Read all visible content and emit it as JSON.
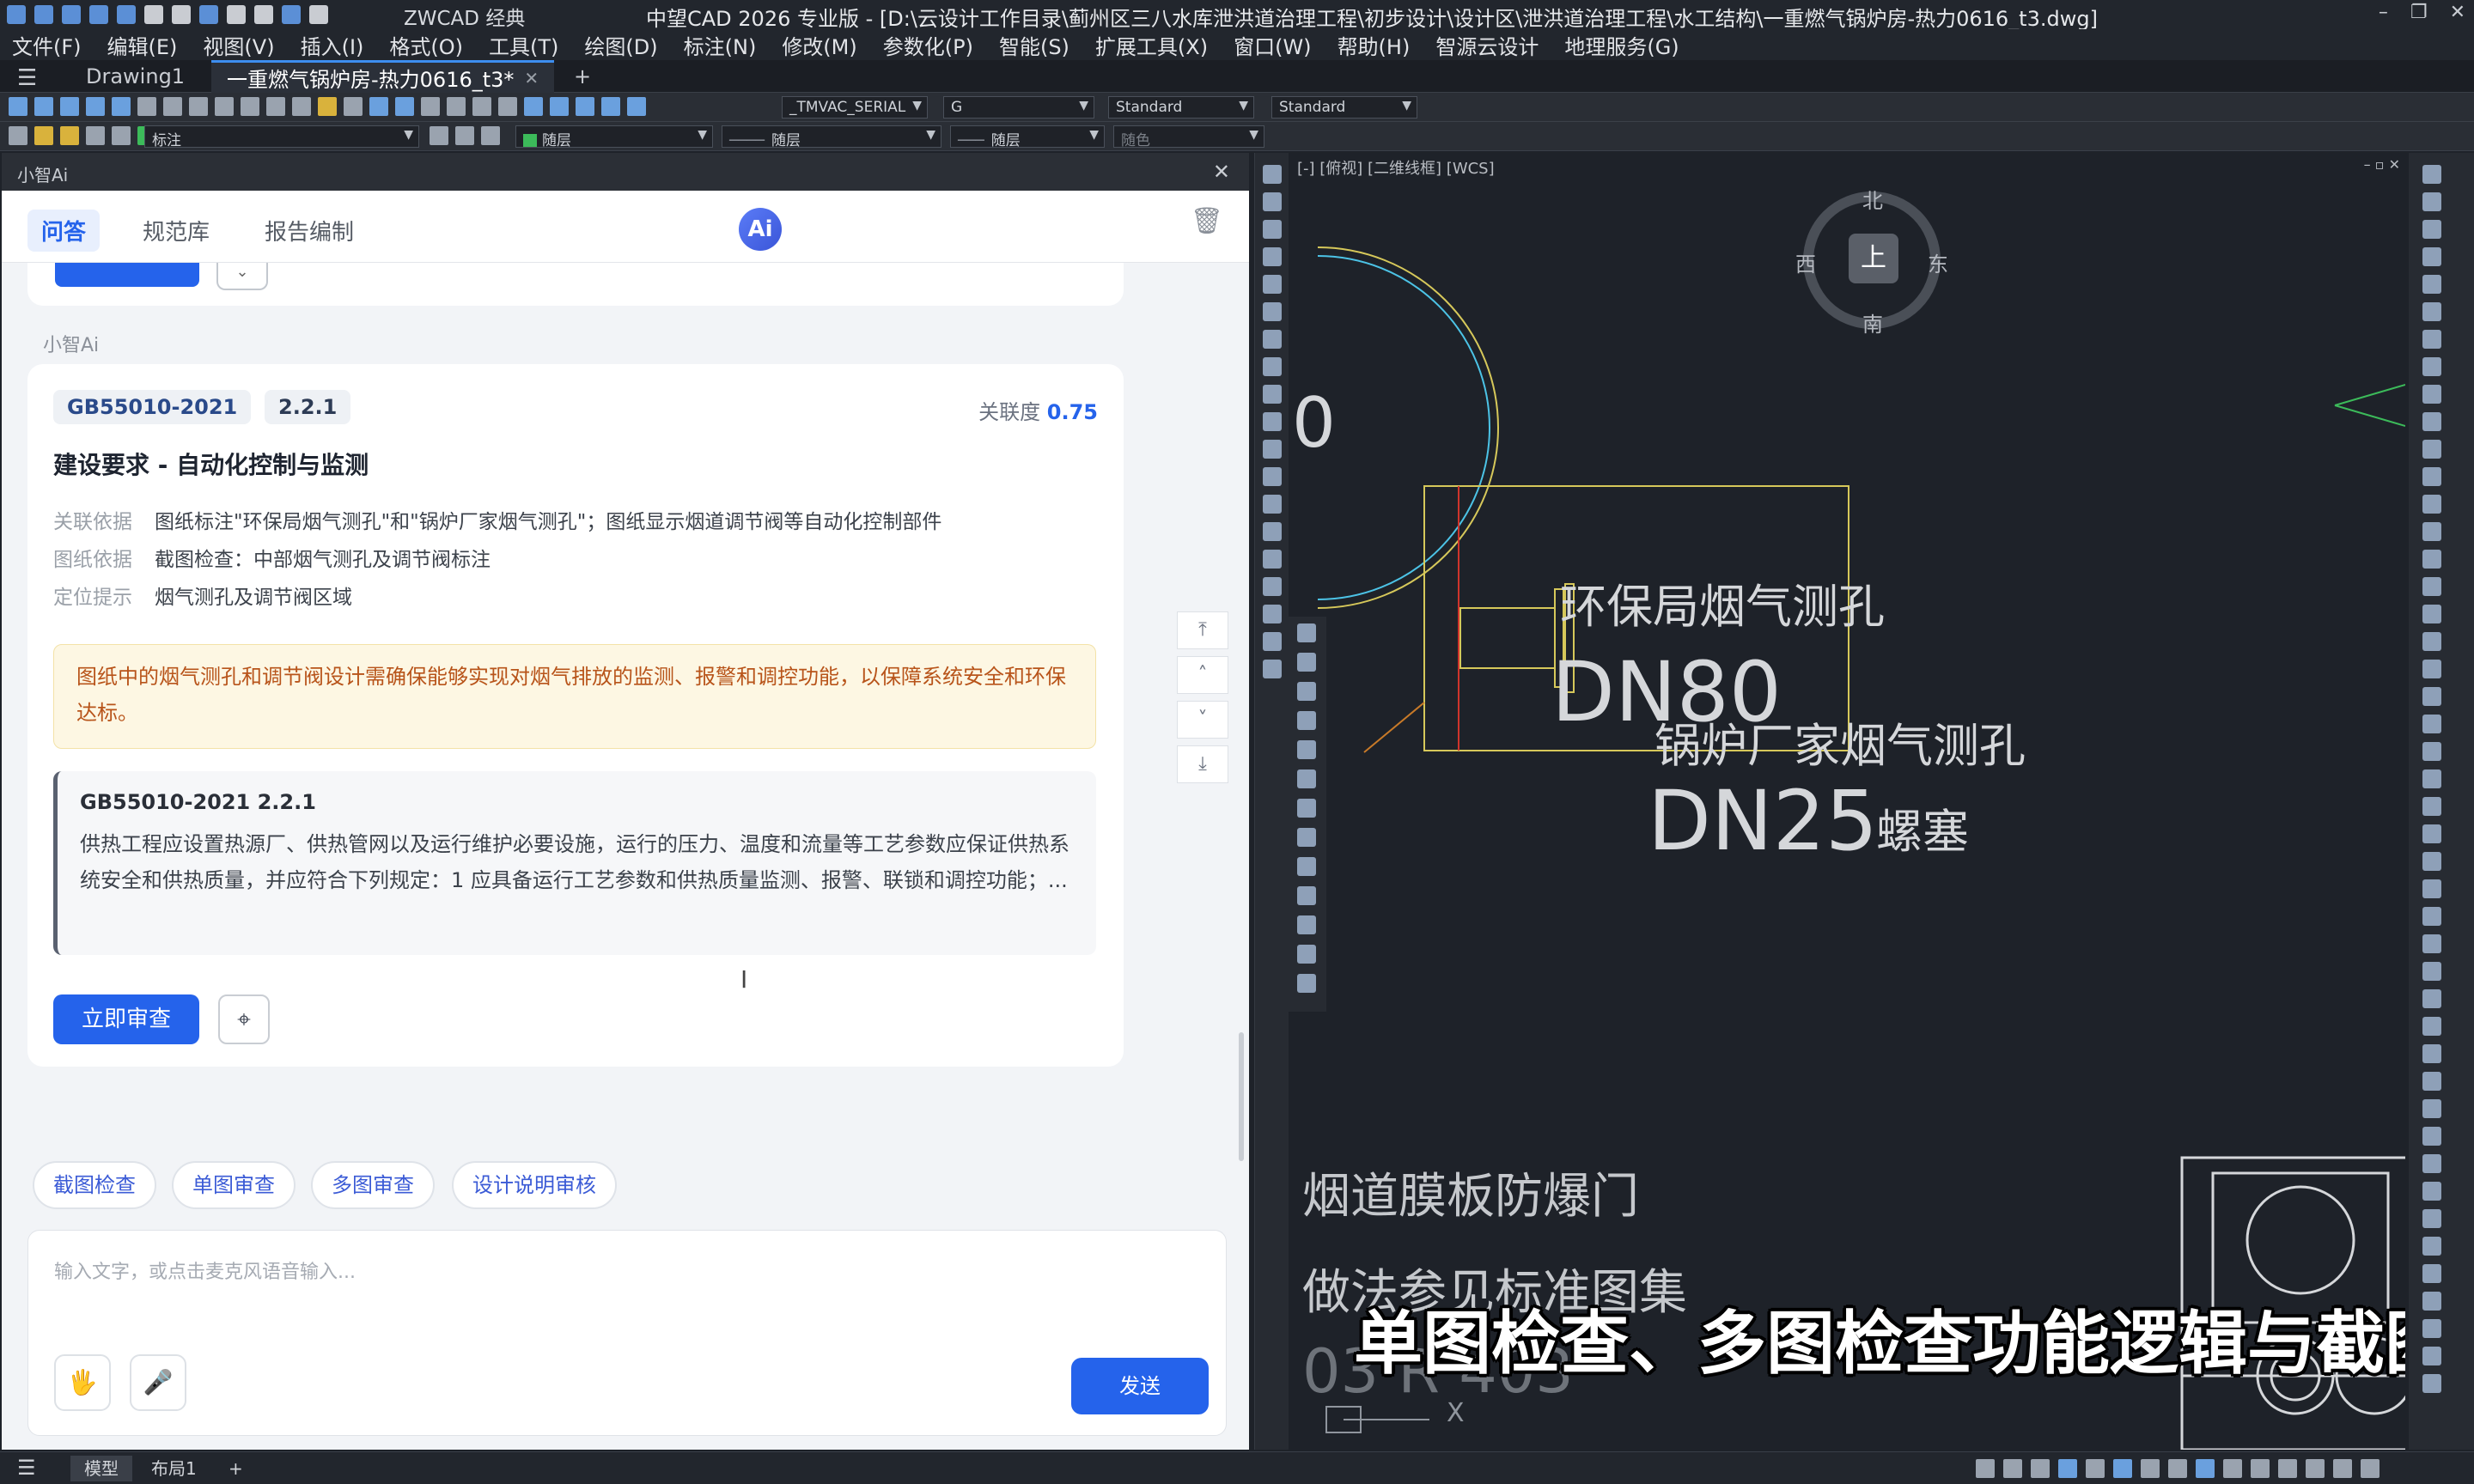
{
  "window": {
    "app_name": "ZWCAD 经典",
    "title": "中望CAD 2026 专业版 - [D:\\云设计工作目录\\蓟州区三八水库泄洪道治理工程\\初步设计\\设计区\\泄洪道治理工程\\水工结构\\一重燃气锅炉房-热力0616_t3.dwg]",
    "controls": [
      "–",
      "❐",
      "✕"
    ]
  },
  "menu": [
    "文件(F)",
    "编辑(E)",
    "视图(V)",
    "插入(I)",
    "格式(O)",
    "工具(T)",
    "绘图(D)",
    "标注(N)",
    "修改(M)",
    "参数化(P)",
    "智能(S)",
    "扩展工具(X)",
    "窗口(W)",
    "帮助(H)",
    "智源云设计",
    "地理服务(G)"
  ],
  "doc_tabs": [
    "Drawing1",
    "一重燃气锅炉房-热力0616_t3*",
    "+"
  ],
  "toolbar": {
    "textstyle": "_TMVAC_SERIAL",
    "dimstyle": "G",
    "tablestyle": "Standard",
    "mlstyle": "Standard",
    "layer": "标注",
    "color": "随层",
    "linetype": "随层",
    "lineweight": "随层",
    "plotstyle": "随色"
  },
  "ai_panel": {
    "header": "小智Ai",
    "close": "✕",
    "tabs": [
      "问答",
      "规范库",
      "报告编制"
    ],
    "logo": "Ai",
    "sender": "小智Ai",
    "card": {
      "code": "GB55010-2021",
      "clause": "2.2.1",
      "relevance_label": "关联度",
      "relevance": "0.75",
      "title": "建设要求 - 自动化控制与监测",
      "meta": [
        {
          "key": "关联依据",
          "value": "图纸标注\"环保局烟气测孔\"和\"锅炉厂家烟气测孔\"；图纸显示烟道调节阀等自动化控制部件"
        },
        {
          "key": "图纸依据",
          "value": "截图检查：中部烟气测孔及调节阀标注"
        },
        {
          "key": "定位提示",
          "value": "烟气测孔及调节阀区域"
        }
      ],
      "warning": "图纸中的烟气测孔和调节阀设计需确保能够实现对烟气排放的监测、报警和调控功能，以保障系统安全和环保达标。",
      "quote_title": "GB55010-2021 2.2.1",
      "quote_body": "供热工程应设置热源厂、供热管网以及运行维护必要设施，运行的压力、温度和流量等工艺参数应保证供热系统安全和供热质量，并应符合下列规定：1 应具备运行工艺参数和供热质量监测、报警、联锁和调控功能；...",
      "review_button": "立即审查"
    },
    "chips": [
      "截图检查",
      "单图审查",
      "多图审查",
      "设计说明审核"
    ],
    "input_placeholder": "输入文字，或点击麦克风语音输入...",
    "send_button": "发送"
  },
  "canvas": {
    "view_label": "[-] [俯视] [二维线框] [WCS]",
    "compass": {
      "n": "北",
      "s": "南",
      "e": "东",
      "w": "西",
      "top": "上"
    },
    "texts": {
      "label_epa": "环保局烟气测孔",
      "dn80": "DN80",
      "label_mfr": "锅炉厂家烟气测孔",
      "dn25": "DN25",
      "plug": "螺塞",
      "zero": "0",
      "door": "烟道膜板防爆门",
      "ref": "做法参见标准图集",
      "partial": "03 R 403",
      "x": "X"
    },
    "subtitle": "单图检查、多图检查功能逻辑与截图审查一致"
  },
  "status": {
    "tabs": [
      "模型",
      "布局1",
      "+"
    ]
  },
  "colors": {
    "accent": "#2563eb",
    "warning_text": "#b8541a",
    "cad_yellow": "#d6c85a",
    "cad_red": "#d0342c"
  }
}
